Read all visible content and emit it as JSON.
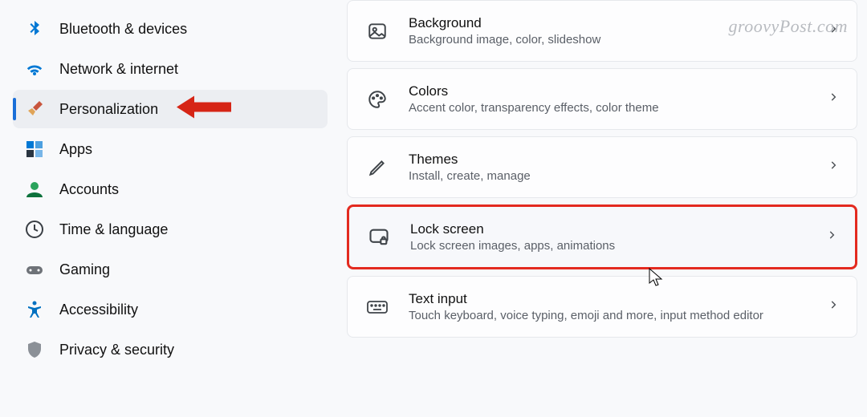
{
  "sidebar": {
    "items": [
      {
        "id": "bluetooth",
        "label": "Bluetooth & devices"
      },
      {
        "id": "network",
        "label": "Network & internet"
      },
      {
        "id": "personalization",
        "label": "Personalization",
        "selected": true
      },
      {
        "id": "apps",
        "label": "Apps"
      },
      {
        "id": "accounts",
        "label": "Accounts"
      },
      {
        "id": "time",
        "label": "Time & language"
      },
      {
        "id": "gaming",
        "label": "Gaming"
      },
      {
        "id": "accessibility",
        "label": "Accessibility"
      },
      {
        "id": "privacy",
        "label": "Privacy & security"
      }
    ]
  },
  "cards": [
    {
      "id": "background",
      "title": "Background",
      "subtitle": "Background image, color, slideshow"
    },
    {
      "id": "colors",
      "title": "Colors",
      "subtitle": "Accent color, transparency effects, color theme"
    },
    {
      "id": "themes",
      "title": "Themes",
      "subtitle": "Install, create, manage"
    },
    {
      "id": "lockscreen",
      "title": "Lock screen",
      "subtitle": "Lock screen images, apps, animations",
      "highlighted": true
    },
    {
      "id": "textinput",
      "title": "Text input",
      "subtitle": "Touch keyboard, voice typing, emoji and more, input method editor"
    }
  ],
  "watermark": "groovyPost.com",
  "annotations": {
    "arrow_target": "personalization",
    "highlight_target": "lockscreen",
    "cursor_over": "lockscreen"
  }
}
